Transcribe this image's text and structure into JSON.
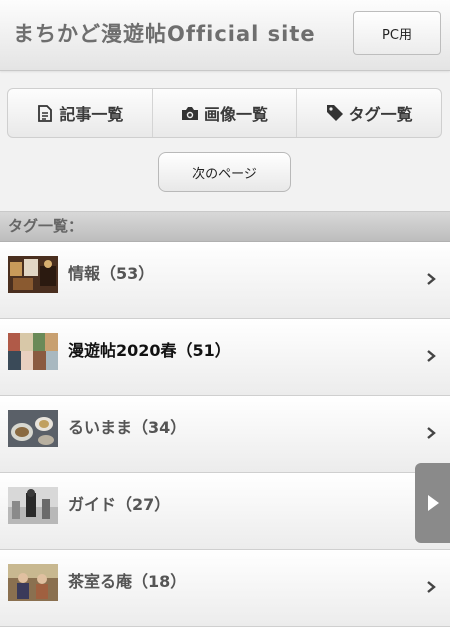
{
  "header": {
    "title": "まちかど漫遊帖Official site",
    "pc_button": "PC用"
  },
  "nav": {
    "items": [
      {
        "label": "記事一覧",
        "icon": "document-icon"
      },
      {
        "label": "画像一覧",
        "icon": "camera-icon"
      },
      {
        "label": "タグ一覧",
        "icon": "tag-icon"
      }
    ]
  },
  "pagination": {
    "next_label": "次のページ"
  },
  "section": {
    "title": "タグ一覧："
  },
  "tags": [
    {
      "label": "情報（53）"
    },
    {
      "label": "漫遊帖2020春（51）"
    },
    {
      "label": "るいまま（34）"
    },
    {
      "label": "ガイド（27）"
    },
    {
      "label": "茶室る庵（18）"
    }
  ],
  "colors": {
    "header_bg": "#f0f0f0",
    "section_bg": "#c9c9c9",
    "float_button": "#8a8a8a"
  }
}
